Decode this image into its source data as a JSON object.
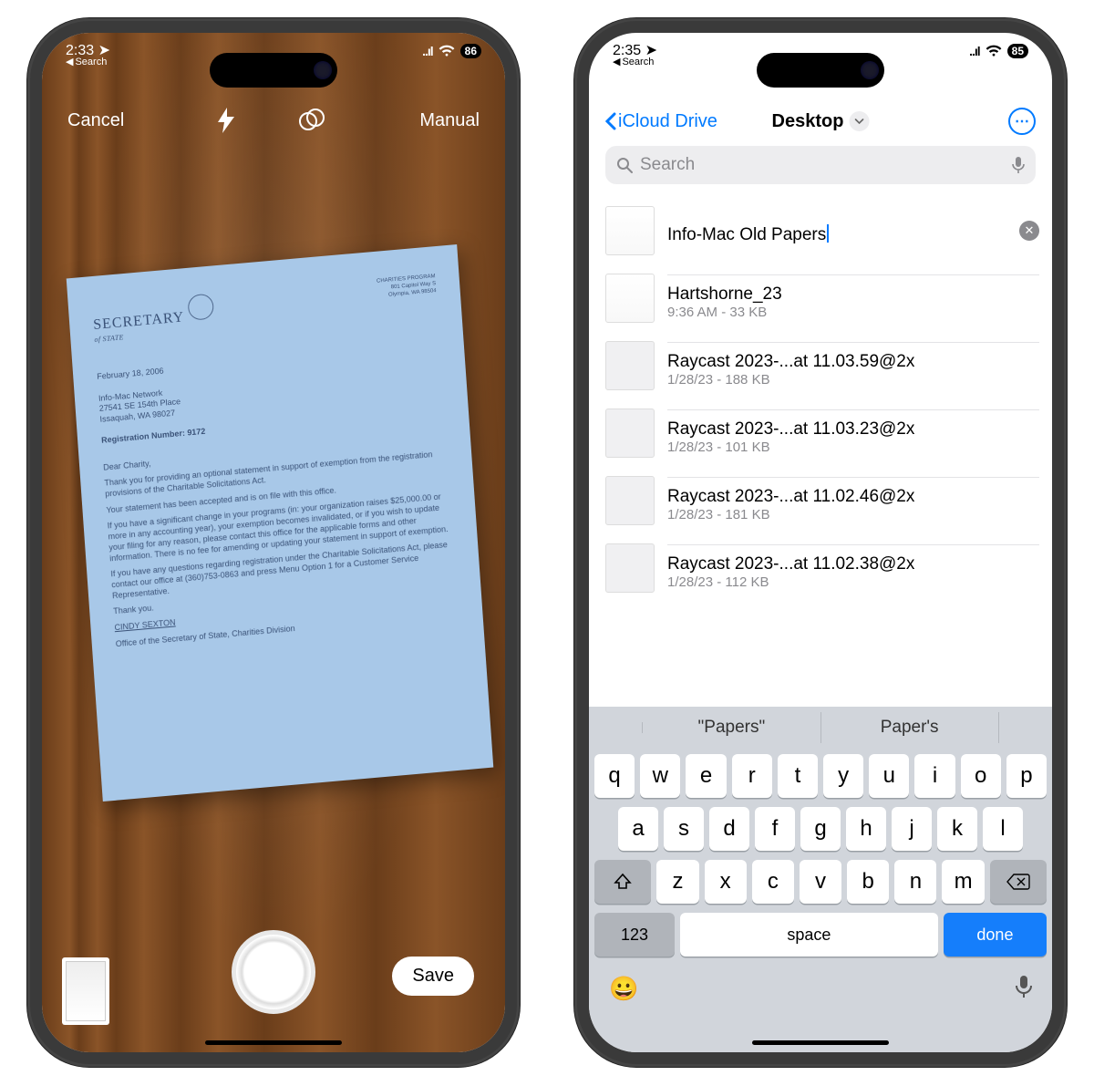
{
  "left": {
    "status": {
      "time": "2:33",
      "back": "Search",
      "battery": "86"
    },
    "toolbar": {
      "cancel": "Cancel",
      "manual": "Manual"
    },
    "save_label": "Save",
    "doc": {
      "agency_line1": "SECRETARY",
      "agency_line2": "of STATE",
      "date": "February 18, 2006",
      "addr1": "Info-Mac Network",
      "addr2": "27541 SE 154th Place",
      "addr3": "Issaquah, WA 98027",
      "reg": "Registration Number: 9172",
      "greet": "Dear Charity,",
      "p1": "Thank you for providing an optional statement in support of exemption from the registration provisions of the Charitable Solicitations Act.",
      "p2": "Your statement has been accepted and is on file with this office.",
      "p3": "If you have a significant change in your programs (in: your organization raises $25,000.00 or more in any accounting year), your exemption becomes invalidated, or if you wish to update your filing for any reason, please contact this office for the applicable forms and other information. There is no fee for amending or updating your statement in support of exemption.",
      "p4": "If you have any questions regarding registration under the Charitable Solicitations Act, please contact our office at (360)753-0863 and press Menu Option 1 for a Customer Service Representative.",
      "thanks": "Thank you.",
      "sig": "CINDY SEXTON",
      "office": "Office of the Secretary of State, Charities Division"
    }
  },
  "right": {
    "status": {
      "time": "2:35",
      "back": "Search",
      "battery": "85"
    },
    "nav": {
      "back_label": "iCloud Drive",
      "title": "Desktop"
    },
    "search": {
      "placeholder": "Search"
    },
    "files": [
      {
        "name": "Info-Mac Old Papers",
        "editing": true
      },
      {
        "name": "Hartshorne_23",
        "meta": "9:36 AM - 33 KB"
      },
      {
        "name": "Raycast 2023-...at 11.03.59@2x",
        "meta": "1/28/23 - 188 KB"
      },
      {
        "name": "Raycast 2023-...at 11.03.23@2x",
        "meta": "1/28/23 - 101 KB"
      },
      {
        "name": "Raycast 2023-...at 11.02.46@2x",
        "meta": "1/28/23 - 181 KB"
      },
      {
        "name": "Raycast 2023-...at 11.02.38@2x",
        "meta": "1/28/23 - 112 KB"
      }
    ],
    "keyboard": {
      "predictions": [
        "\"Papers\"",
        "Paper's"
      ],
      "rows": [
        [
          "q",
          "w",
          "e",
          "r",
          "t",
          "y",
          "u",
          "i",
          "o",
          "p"
        ],
        [
          "a",
          "s",
          "d",
          "f",
          "g",
          "h",
          "j",
          "k",
          "l"
        ],
        [
          "z",
          "x",
          "c",
          "v",
          "b",
          "n",
          "m"
        ]
      ],
      "num": "123",
      "space": "space",
      "done": "done"
    }
  }
}
